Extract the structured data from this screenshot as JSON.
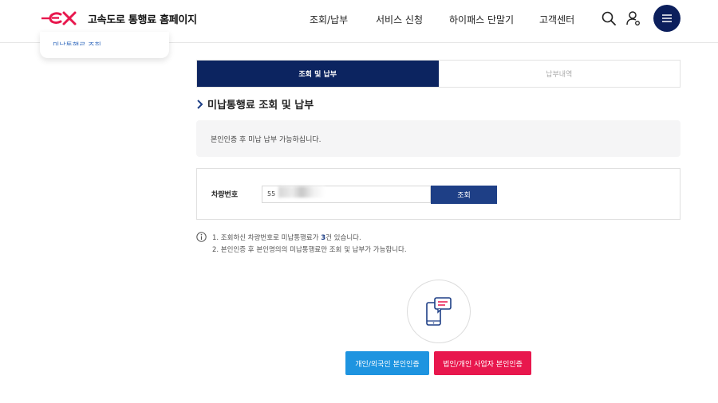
{
  "header": {
    "logo_mark": "ex",
    "site_title": "고속도로 통행료 홈페이지",
    "nav": [
      "조회/납부",
      "서비스 신청",
      "하이패스 단말기",
      "고객센터"
    ],
    "icons": [
      "search-icon",
      "user-icon",
      "menu-icon"
    ],
    "brand_color": "#0c1f5c",
    "logo_color": "#e8174d"
  },
  "sidebar": {
    "partial_item": "미납통행료 조회"
  },
  "tabs": [
    {
      "label": "조회 및 납부",
      "active": true
    },
    {
      "label": "납부내역",
      "active": false
    }
  ],
  "section": {
    "title": "미납통행료 조회 및 납부"
  },
  "info": {
    "text": "본인인증 후 미납 납부 가능하십니다."
  },
  "form": {
    "label": "차량번호",
    "value": "55",
    "search_label": "조회"
  },
  "notes": {
    "line1_pre": "1. 조회하신 차량번호로 미납통행료가 ",
    "line1_count": "3",
    "line1_post": "건 있습니다.",
    "line2": "2. 본인인증 후 본인명의의 미납통행료만 조회 및 납부가 가능합니다."
  },
  "auth": {
    "personal_label": "개인/외국인 본인인증",
    "corporate_label": "법인/개인 사업자 본인인증",
    "personal_color": "#1e94e0",
    "corporate_color": "#e8174d"
  }
}
